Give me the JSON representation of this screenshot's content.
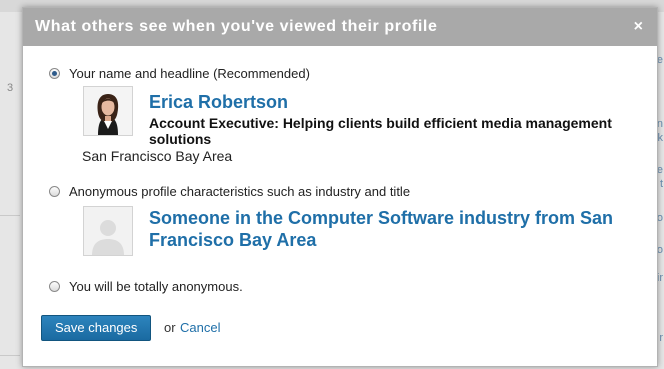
{
  "dialog": {
    "title": "What others see when you've viewed their profile",
    "close_icon": "×"
  },
  "options": [
    {
      "label": "Your name and headline (Recommended)",
      "selected": true,
      "preview": {
        "name": "Erica Robertson",
        "headline": "Account Executive: Helping clients build efficient media management solutions",
        "location": "San Francisco Bay Area",
        "avatar": "profile-photo"
      }
    },
    {
      "label": "Anonymous profile characteristics such as industry and title",
      "selected": false,
      "preview": {
        "text": "Someone in the Computer Software industry from San Francisco Bay Area",
        "avatar": "silhouette-icon"
      }
    },
    {
      "label": "You will be totally anonymous.",
      "selected": false
    }
  ],
  "actions": {
    "save_label": "Save changes",
    "or_text": "or",
    "cancel_label": "Cancel"
  },
  "background": {
    "left_digit": "3",
    "right_fragments": [
      "e",
      "n",
      "ik",
      "e",
      "t",
      "o",
      "o",
      "ir",
      "r"
    ]
  },
  "colors": {
    "header": "#a9a9a9",
    "link": "#1f6fa8",
    "primary_button": "#1a6aa1"
  }
}
